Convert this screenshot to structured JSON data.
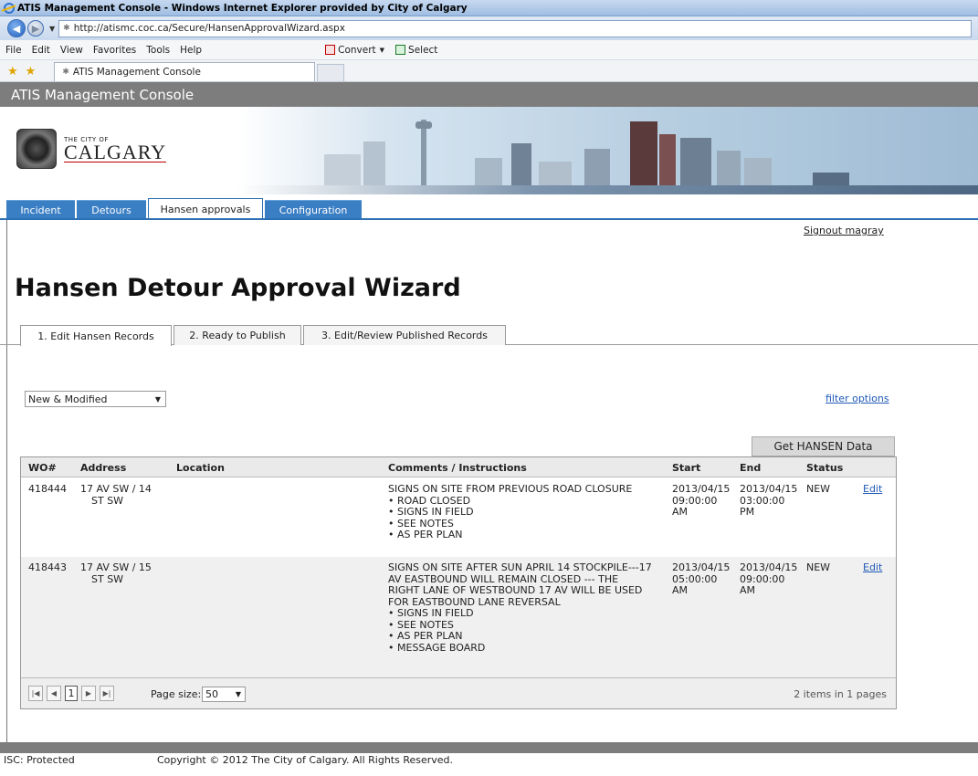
{
  "browser": {
    "window_title": "ATIS Management Console - Windows Internet Explorer provided by City of Calgary",
    "address": "http://atismc.coc.ca/Secure/HansenApprovalWizard.aspx",
    "menu": [
      "File",
      "Edit",
      "View",
      "Favorites",
      "Tools",
      "Help"
    ],
    "toolbar": {
      "convert": "Convert",
      "select": "Select"
    },
    "tab_title": "ATIS Management Console"
  },
  "app": {
    "header": "ATIS Management Console",
    "logo": {
      "small": "THE CITY OF",
      "big": "CALGARY"
    },
    "nav_tabs": [
      "Incident",
      "Detours",
      "Hansen approvals",
      "Configuration"
    ],
    "active_nav": "Hansen approvals",
    "signout": "Signout magray"
  },
  "page": {
    "title": "Hansen Detour Approval Wizard",
    "wizard_tabs": [
      "1. Edit Hansen Records",
      "2. Ready to Publish",
      "3. Edit/Review Published Records"
    ],
    "filter_value": "New & Modified",
    "filter_options": "filter options",
    "get_data": "Get HANSEN Data"
  },
  "grid": {
    "columns": [
      "WO#",
      "Address",
      "Location",
      "Comments / Instructions",
      "Start",
      "End",
      "Status"
    ],
    "rows": [
      {
        "wo": "418444",
        "address": [
          "17 AV SW / 14",
          "ST SW"
        ],
        "location": "",
        "comment": [
          "SIGNS ON SITE FROM PREVIOUS ROAD CLOSURE"
        ],
        "bullets": [
          "ROAD CLOSED",
          "SIGNS IN FIELD",
          "SEE NOTES",
          "AS PER PLAN"
        ],
        "start": [
          "2013/04/15",
          "09:00:00",
          "AM"
        ],
        "end": [
          "2013/04/15",
          "03:00:00",
          "PM"
        ],
        "status": "NEW",
        "action": "Edit"
      },
      {
        "wo": "418443",
        "address": [
          "17 AV SW / 15",
          "ST SW"
        ],
        "location": "",
        "comment": [
          "SIGNS ON SITE AFTER SUN APRIL 14 STOCKPILE---17",
          "AV EASTBOUND WILL REMAIN CLOSED --- THE",
          "RIGHT LANE OF WESTBOUND 17 AV WILL BE USED",
          "FOR EASTBOUND LANE REVERSAL"
        ],
        "bullets": [
          "SIGNS IN FIELD",
          "SEE NOTES",
          "AS PER PLAN",
          "MESSAGE BOARD"
        ],
        "start": [
          "2013/04/15",
          "05:00:00",
          "AM"
        ],
        "end": [
          "2013/04/15",
          "09:00:00",
          "AM"
        ],
        "status": "NEW",
        "action": "Edit"
      }
    ],
    "pager": {
      "page": "1",
      "page_size_label": "Page size:",
      "page_size": "50",
      "info": "2 items in 1 pages"
    }
  },
  "footer": {
    "classification": "ISC: Protected",
    "copyright": "Copyright © 2012 The City of Calgary. All Rights Reserved."
  }
}
